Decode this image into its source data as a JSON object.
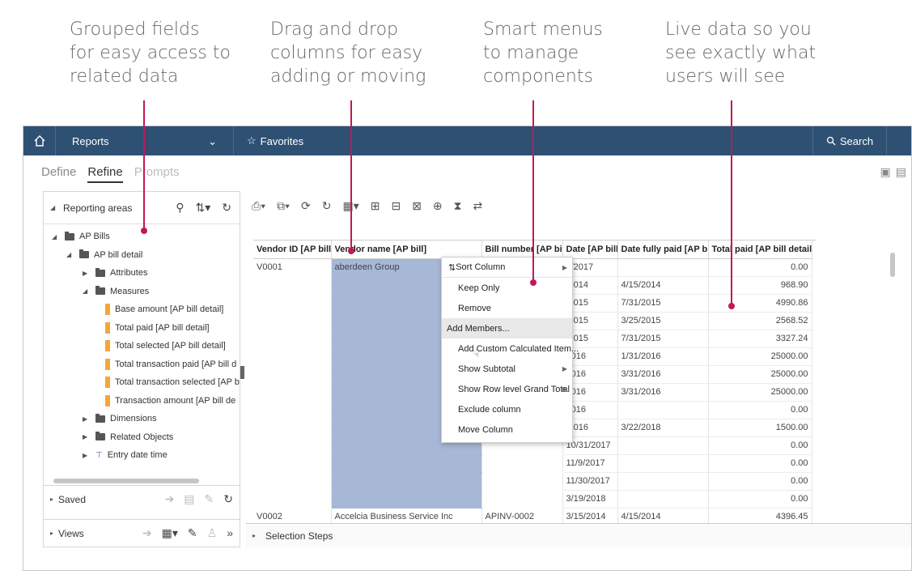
{
  "callouts": [
    {
      "lines": [
        "Grouped fields",
        "for easy access to",
        "related data"
      ]
    },
    {
      "lines": [
        "Drag and drop",
        "columns for easy",
        "adding or moving"
      ]
    },
    {
      "lines": [
        "Smart menus",
        "to manage",
        "components"
      ]
    },
    {
      "lines": [
        "Live data so you",
        "see exactly what",
        "users will see"
      ]
    }
  ],
  "colors": {
    "accent_pointer": "#c1185b",
    "topbar": "#2e5173",
    "selected_column": "#a7b7d6",
    "measure_icon": "#f2a73b"
  },
  "topbar": {
    "home_icon": "home-icon",
    "reports_label": "Reports",
    "favorites_label": "Favorites",
    "search_label": "Search"
  },
  "tabs": [
    {
      "label": "Define",
      "state": "inactive"
    },
    {
      "label": "Refine",
      "state": "active"
    },
    {
      "label": "Prompts",
      "state": "disabled"
    }
  ],
  "left_panel": {
    "header": "Reporting areas",
    "tree": [
      {
        "label": "AP Bills",
        "indent": 0,
        "icon": "folder",
        "expanded": true
      },
      {
        "label": "AP bill detail",
        "indent": 1,
        "icon": "folder",
        "expanded": true
      },
      {
        "label": "Attributes",
        "indent": 2,
        "icon": "folder",
        "expanded": false
      },
      {
        "label": "Measures",
        "indent": 2,
        "icon": "folder",
        "expanded": true
      },
      {
        "label": "Base amount [AP bill detail]",
        "indent": 3,
        "icon": "measure"
      },
      {
        "label": "Total paid [AP bill detail]",
        "indent": 3,
        "icon": "measure"
      },
      {
        "label": "Total selected [AP bill detail]",
        "indent": 3,
        "icon": "measure"
      },
      {
        "label": "Total transaction paid [AP bill d",
        "indent": 3,
        "icon": "measure"
      },
      {
        "label": "Total transaction selected [AP b",
        "indent": 3,
        "icon": "measure"
      },
      {
        "label": "Transaction amount [AP bill de",
        "indent": 3,
        "icon": "measure"
      },
      {
        "label": "Dimensions",
        "indent": 2,
        "icon": "folder",
        "expanded": false
      },
      {
        "label": "Related Objects",
        "indent": 2,
        "icon": "folder",
        "expanded": false
      },
      {
        "label": "Entry date time",
        "indent": 2,
        "icon": "hierarchy",
        "expanded": false
      }
    ],
    "saved_label": "Saved",
    "views_label": "Views"
  },
  "grid": {
    "columns": [
      "Vendor ID [AP bill]",
      "Vendor name [AP bill]",
      "Bill number [AP bill]",
      "Date [AP bill]",
      "Date fully paid [AP bill]",
      "Total paid [AP bill detail]"
    ],
    "rows": [
      [
        "V0001",
        "aberdeen Group",
        "",
        "1/2017",
        "",
        "0.00"
      ],
      [
        "",
        "",
        "",
        "/2014",
        "4/15/2014",
        "968.90"
      ],
      [
        "",
        "",
        "",
        "/2015",
        "7/31/2015",
        "4990.86"
      ],
      [
        "",
        "",
        "",
        "/2015",
        "3/25/2015",
        "2568.52"
      ],
      [
        "",
        "",
        "",
        "/2015",
        "7/31/2015",
        "3327.24"
      ],
      [
        "",
        "",
        "",
        "2016",
        "1/31/2016",
        "25000.00"
      ],
      [
        "",
        "",
        "",
        "2016",
        "3/31/2016",
        "25000.00"
      ],
      [
        "",
        "",
        "",
        "2016",
        "3/31/2016",
        "25000.00"
      ],
      [
        "",
        "",
        "",
        "2016",
        "",
        "0.00"
      ],
      [
        "",
        "",
        "",
        "/2016",
        "3/22/2018",
        "1500.00"
      ],
      [
        "",
        "",
        "",
        "10/31/2017",
        "",
        "0.00"
      ],
      [
        "",
        "",
        "",
        "11/9/2017",
        "",
        "0.00"
      ],
      [
        "",
        "",
        "",
        "11/30/2017",
        "",
        "0.00"
      ],
      [
        "",
        "",
        "",
        "3/19/2018",
        "",
        "0.00"
      ],
      [
        "V0002",
        "Accelcia Business Service Inc",
        "APINV-0002",
        "3/15/2014",
        "4/15/2014",
        "4396.45"
      ]
    ]
  },
  "context_menu": {
    "items": [
      {
        "label": "Sort Column",
        "submenu": true
      },
      {
        "label": "Keep Only",
        "submenu": false
      },
      {
        "label": "Remove",
        "submenu": false
      },
      {
        "label": "Add Members...",
        "submenu": false
      },
      {
        "label": "Add Custom Calculated Item...",
        "submenu": false
      },
      {
        "label": "Show Subtotal",
        "submenu": true
      },
      {
        "label": "Show Row level Grand Total",
        "submenu": true
      },
      {
        "label": "Exclude column",
        "submenu": false
      },
      {
        "label": "Move Column",
        "submenu": false
      }
    ]
  },
  "selection_steps_label": "Selection Steps"
}
